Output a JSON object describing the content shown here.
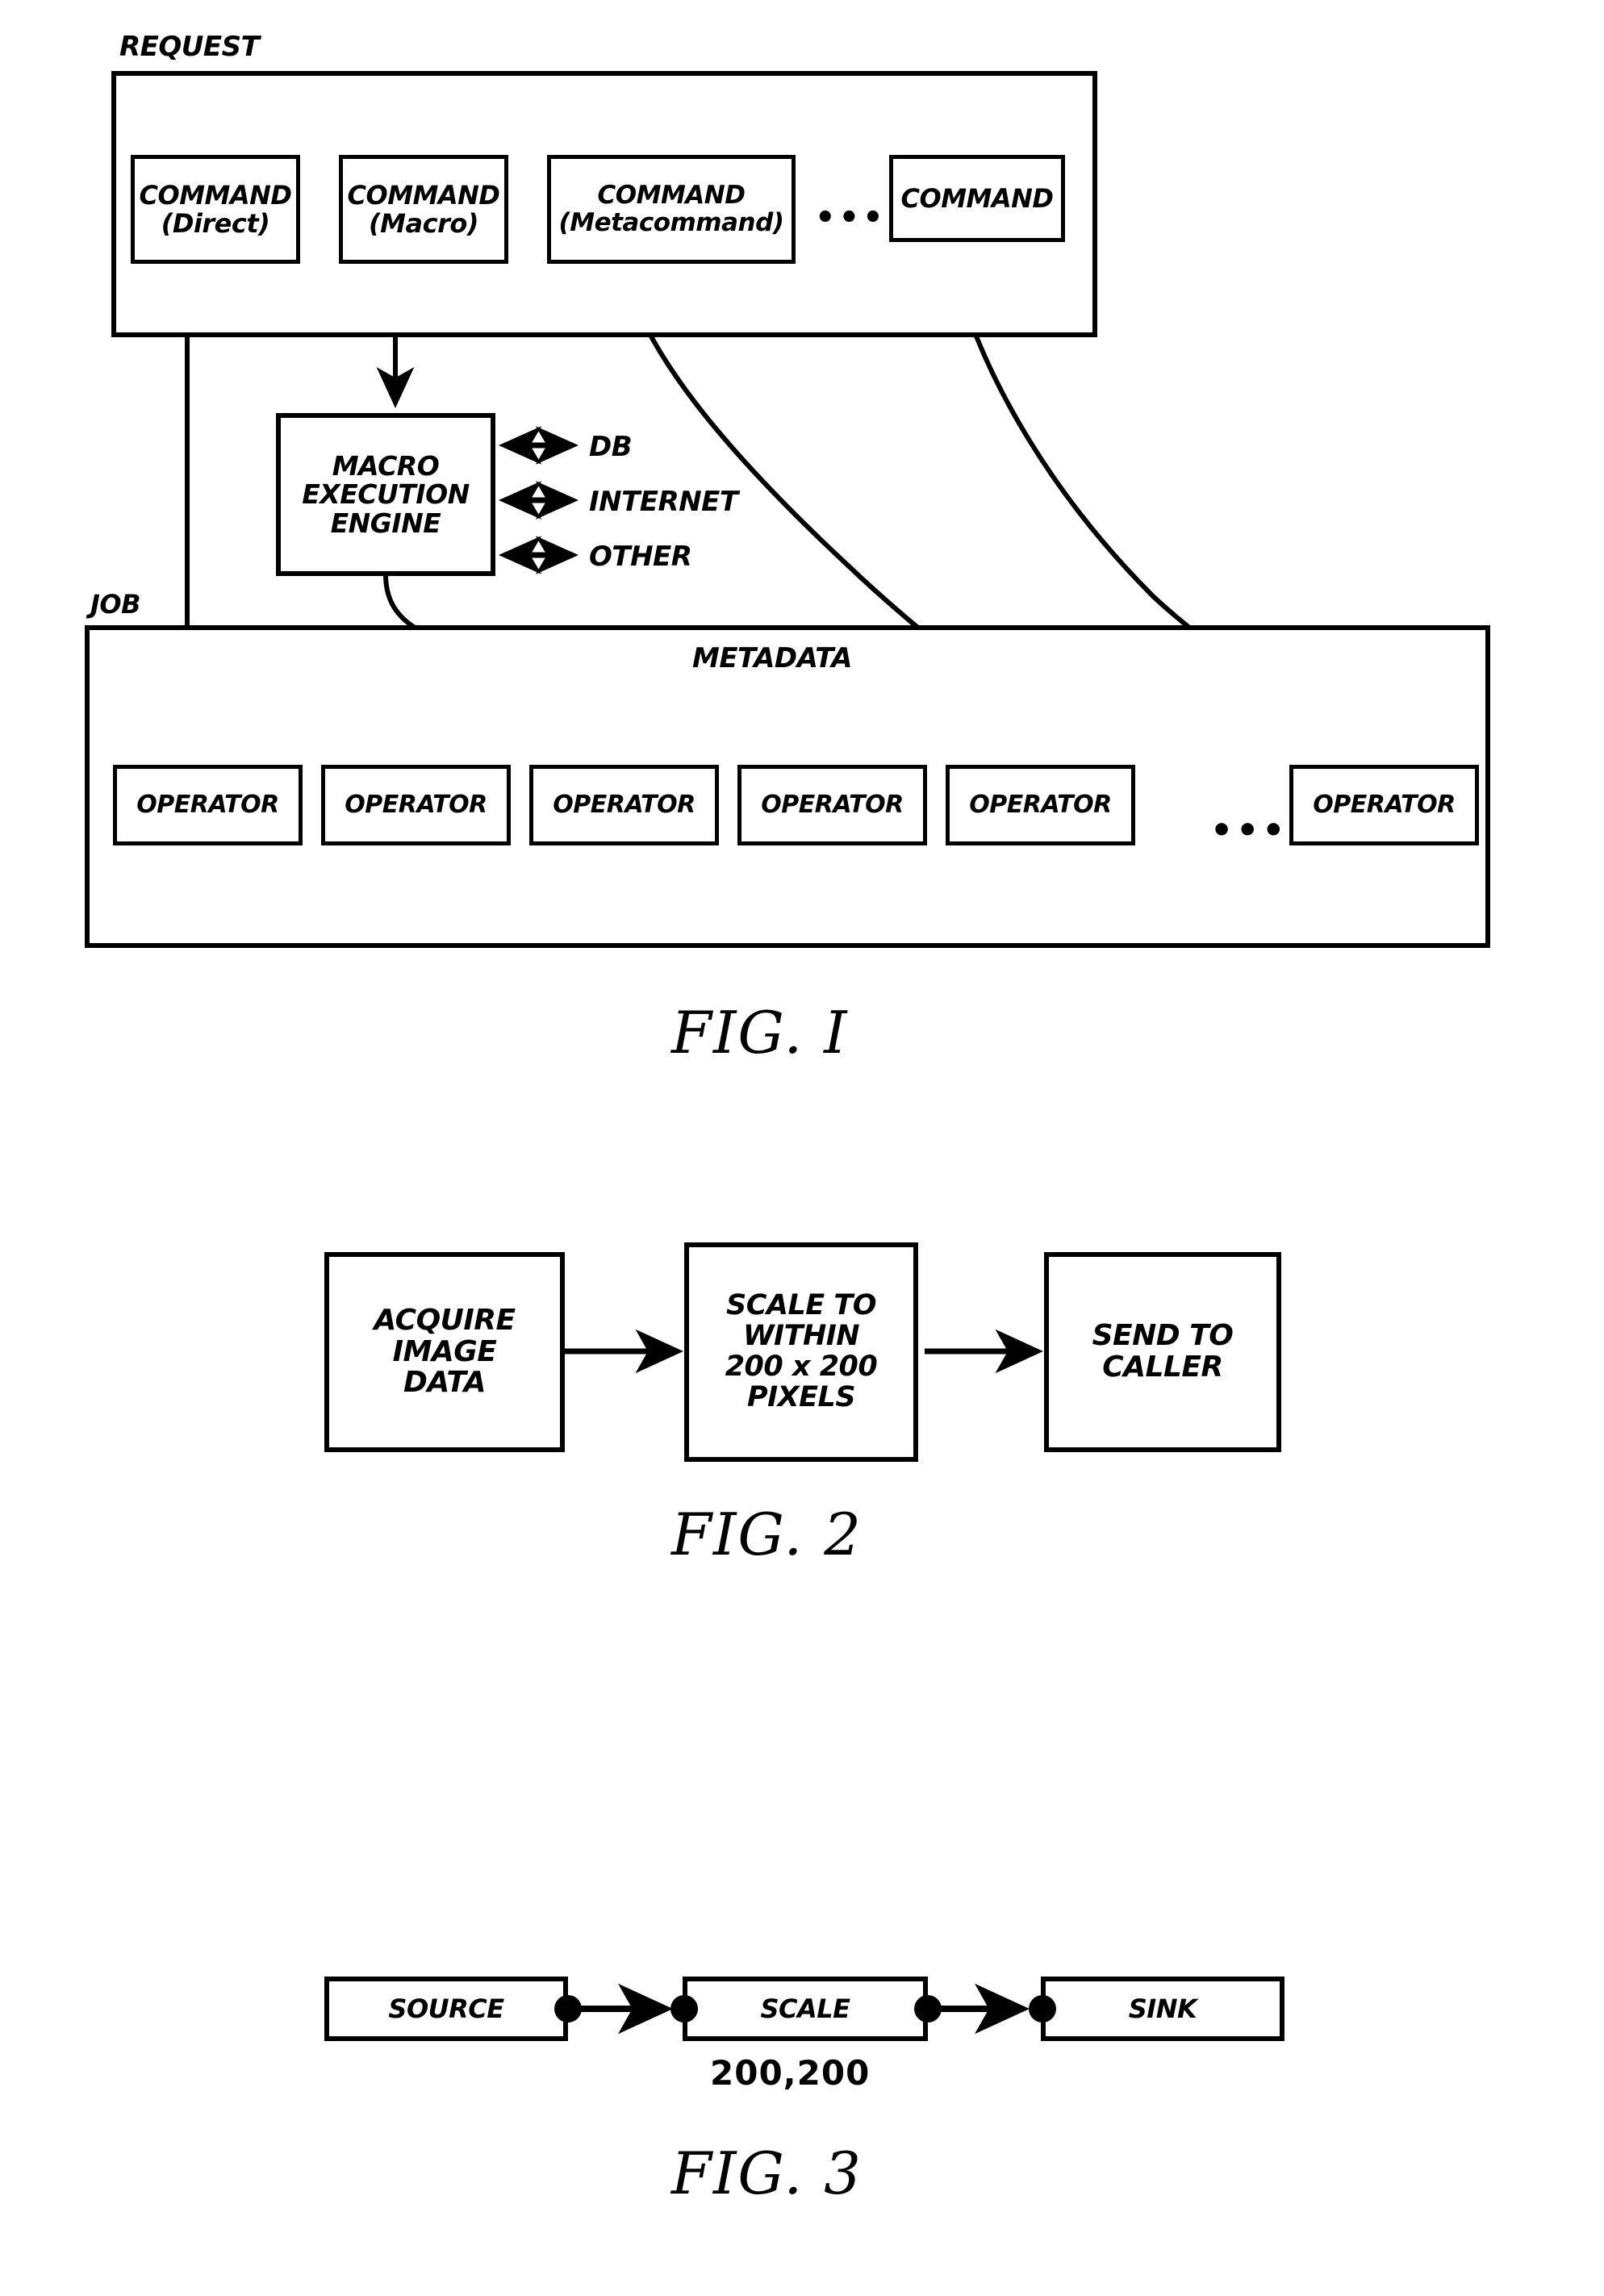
{
  "figures": [
    {
      "caption": "FIG. I",
      "request_label": "REQUEST",
      "job_label": "JOB",
      "metadata_label": "METADATA",
      "commands": [
        {
          "title": "COMMAND",
          "subtitle": "(Direct)"
        },
        {
          "title": "COMMAND",
          "subtitle": "(Macro)"
        },
        {
          "title": "COMMAND",
          "subtitle": "(Metacommand)"
        },
        {
          "title": "COMMAND",
          "subtitle": ""
        }
      ],
      "command_ellipsis": "•••",
      "engine": {
        "line1": "MACRO",
        "line2": "EXECUTION",
        "line3": "ENGINE"
      },
      "engine_channels": [
        "DB",
        "INTERNET",
        "OTHER"
      ],
      "operators": [
        {
          "label": "OPERATOR"
        },
        {
          "label": "OPERATOR"
        },
        {
          "label": "OPERATOR"
        },
        {
          "label": "OPERATOR"
        },
        {
          "label": "OPERATOR"
        },
        {
          "label": "OPERATOR"
        }
      ],
      "operator_ellipsis": "•••"
    },
    {
      "caption": "FIG. 2",
      "steps": [
        {
          "label": "ACQUIRE\nIMAGE\nDATA"
        },
        {
          "label": "SCALE TO\nWITHIN\n200 x 200\nPIXELS"
        },
        {
          "label": "SEND TO\nCALLER"
        }
      ]
    },
    {
      "caption": "FIG. 3",
      "nodes": [
        {
          "label": "SOURCE"
        },
        {
          "label": "SCALE"
        },
        {
          "label": "SINK"
        }
      ],
      "scale_param": "200,200"
    }
  ],
  "colors": {
    "ink": "#000000",
    "paper": "#ffffff"
  }
}
